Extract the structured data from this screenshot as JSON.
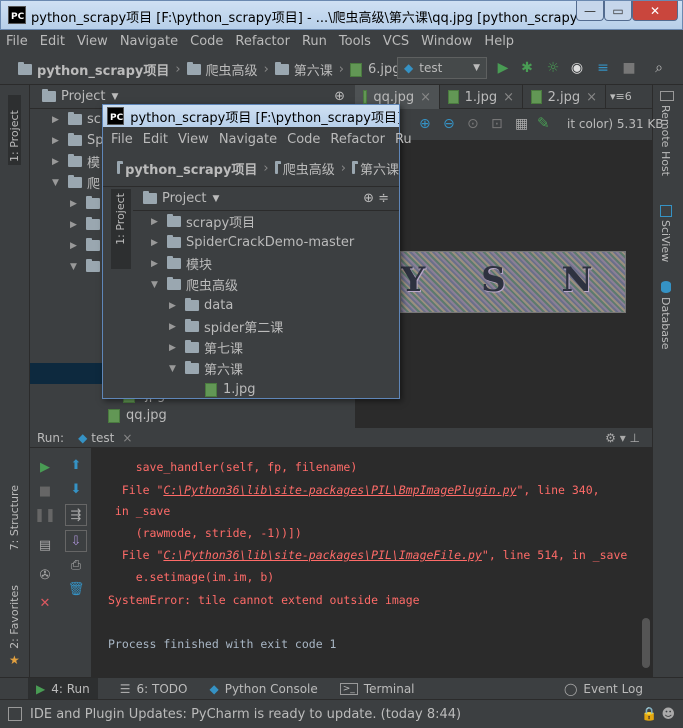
{
  "window": {
    "title": "python_scrapy项目 [F:\\python_scrapy项目] - ...\\爬虫高级\\第六课\\qq.jpg [python_scrapy] - PyCharm",
    "logo": "PC"
  },
  "menu": [
    "File",
    "Edit",
    "View",
    "Navigate",
    "Code",
    "Refactor",
    "Run",
    "Tools",
    "VCS",
    "Window",
    "Help"
  ],
  "breadcrumb": [
    "python_scrapy项目",
    "爬虫高级",
    "第六课",
    "6.jpg"
  ],
  "run_config": "test",
  "left_strip": {
    "project": "1: Project",
    "structure": "7: Structure",
    "favorites": "2: Favorites"
  },
  "right_strip": {
    "remote_host": "Remote Host",
    "sciview": "SciView",
    "database": "Database"
  },
  "project_panel": {
    "title": "Project",
    "items": [
      {
        "label": "sc",
        "indent": 1,
        "expanded": false
      },
      {
        "label": "Sp",
        "indent": 1,
        "expanded": false
      },
      {
        "label": "模",
        "indent": 1,
        "expanded": false
      },
      {
        "label": "爬",
        "indent": 1,
        "expanded": true
      },
      {
        "label": "",
        "indent": 2,
        "expanded": false
      },
      {
        "label": "",
        "indent": 2,
        "expanded": false
      },
      {
        "label": "",
        "indent": 2,
        "expanded": false
      },
      {
        "label": "",
        "indent": 2,
        "expanded": true
      }
    ],
    "files_below": [
      ".jpg",
      "qq.jpg"
    ]
  },
  "editor": {
    "tabs": [
      "qq.jpg",
      "1.jpg",
      "2.jpg"
    ],
    "tab_count": "6",
    "image_info": "it color) 5.31 KB",
    "captcha_text": "Y S N t"
  },
  "inner_window": {
    "title": "python_scrapy项目 [F:\\python_scrapy项目] - ...\\",
    "menu": [
      "File",
      "Edit",
      "View",
      "Navigate",
      "Code",
      "Refactor",
      "Ru"
    ],
    "breadcrumb": [
      "python_scrapy项目",
      "爬虫高级",
      "第六课"
    ],
    "strip_label": "1: Project",
    "panel_title": "Project",
    "tree": [
      {
        "label": "scrapy项目",
        "indent": 0,
        "type": "folder",
        "expanded": false
      },
      {
        "label": "SpiderCrackDemo-master",
        "indent": 0,
        "type": "folder",
        "expanded": false
      },
      {
        "label": "模块",
        "indent": 0,
        "type": "folder",
        "expanded": false
      },
      {
        "label": "爬虫高级",
        "indent": 0,
        "type": "folder",
        "expanded": true
      },
      {
        "label": "data",
        "indent": 1,
        "type": "folder",
        "expanded": false
      },
      {
        "label": "spider第二课",
        "indent": 1,
        "type": "folder",
        "expanded": false
      },
      {
        "label": "第七课",
        "indent": 1,
        "type": "folder",
        "expanded": false
      },
      {
        "label": "第六课",
        "indent": 1,
        "type": "folder",
        "expanded": true
      },
      {
        "label": "1.jpg",
        "indent": 2,
        "type": "image",
        "expanded": false
      }
    ]
  },
  "run_panel": {
    "label": "Run:",
    "tab": "test",
    "lines": [
      {
        "text": "    save_handler(self, fp, filename)"
      },
      {
        "pre": "  File \"",
        "link": "C:\\Python36\\lib\\site-packages\\PIL\\BmpImagePlugin.py",
        "post": "\", line 340,"
      },
      {
        "text": " in _save"
      },
      {
        "text": "    (rawmode, stride, -1))])"
      },
      {
        "pre": "  File \"",
        "link": "C:\\Python36\\lib\\site-packages\\PIL\\ImageFile.py",
        "post": "\", line 514, in _save"
      },
      {
        "text": "    e.setimage(im.im, b)"
      },
      {
        "text": "SystemError: tile cannot extend outside image"
      },
      {
        "text": ""
      },
      {
        "text": "Process finished with exit code 1",
        "color": "#a9b7c6"
      }
    ]
  },
  "bottom_tabs": [
    {
      "label": "4: Run",
      "icon": "run-icon"
    },
    {
      "label": "6: TODO",
      "icon": "todo-icon"
    },
    {
      "label": "Python Console",
      "icon": "python-icon"
    },
    {
      "label": "Terminal",
      "icon": "terminal-icon"
    }
  ],
  "event_log": "Event Log",
  "status": "IDE and Plugin Updates: PyCharm is ready to update. (today 8:44)",
  "colors": {
    "error": "#ff6b68",
    "accent": "#499c54",
    "bg": "#2b2b2b",
    "panel": "#3c3f41"
  }
}
